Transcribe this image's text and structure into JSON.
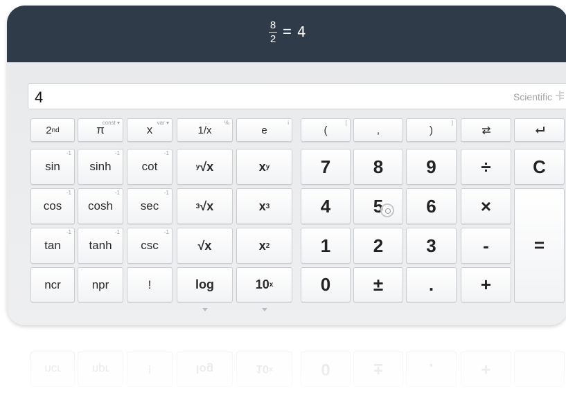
{
  "header": {
    "numerator": "8",
    "denominator": "2",
    "equals": "=",
    "result": "4"
  },
  "display": {
    "value": "4",
    "mode_label": "Scientific"
  },
  "keys": {
    "second": {
      "base": "2",
      "sup": "nd"
    },
    "pi": {
      "label": "π",
      "corner": "const ▾"
    },
    "x_var": {
      "label": "x",
      "corner": "var ▾"
    },
    "reciprocal": {
      "label": "1/x",
      "corner": "%"
    },
    "e": {
      "label": "e",
      "corner": "i"
    },
    "lparen": {
      "label": "(",
      "corner": "["
    },
    "comma": {
      "label": ","
    },
    "rparen": {
      "label": ")",
      "corner": "]"
    },
    "swap": {
      "icon": "swap-arrows-icon"
    },
    "backspace": {
      "icon": "backspace-arrow-icon"
    },
    "sin": {
      "label": "sin",
      "corner": "-1"
    },
    "sinh": {
      "label": "sinh",
      "corner": "-1"
    },
    "cot": {
      "label": "cot",
      "corner": "-1"
    },
    "y_root": {
      "sup": "y",
      "label": "√x"
    },
    "x_pow_y": {
      "label": "x",
      "sup": "y"
    },
    "seven": {
      "label": "7"
    },
    "eight": {
      "label": "8"
    },
    "nine": {
      "label": "9"
    },
    "divide": {
      "label": "÷"
    },
    "clear": {
      "label": "C"
    },
    "cos": {
      "label": "cos",
      "corner": "-1"
    },
    "cosh": {
      "label": "cosh",
      "corner": "-1"
    },
    "sec": {
      "label": "sec",
      "corner": "-1"
    },
    "cube_root": {
      "sup": "3",
      "label": "√x"
    },
    "x_cubed": {
      "label": "x",
      "sup": "3"
    },
    "four": {
      "label": "4"
    },
    "five": {
      "label": "5"
    },
    "six": {
      "label": "6"
    },
    "multiply": {
      "label": "×"
    },
    "equals": {
      "label": "="
    },
    "tan": {
      "label": "tan",
      "corner": "-1"
    },
    "tanh": {
      "label": "tanh",
      "corner": "-1"
    },
    "csc": {
      "label": "csc",
      "corner": "-1"
    },
    "sqrt": {
      "label": "√x"
    },
    "x_squared": {
      "label": "x",
      "sup": "2"
    },
    "one": {
      "label": "1"
    },
    "two": {
      "label": "2"
    },
    "three": {
      "label": "3"
    },
    "minus": {
      "label": "-"
    },
    "ncr": {
      "label": "ncr"
    },
    "npr": {
      "label": "npr"
    },
    "factorial": {
      "label": "!"
    },
    "log": {
      "label": "log"
    },
    "ten_pow": {
      "label": "10",
      "sup": "x"
    },
    "zero": {
      "label": "0"
    },
    "plus_minus": {
      "label": "±"
    },
    "decimal": {
      "label": "."
    },
    "plus": {
      "label": "+"
    }
  },
  "reflection": {
    "ncr": "ncr",
    "npr": "npr",
    "factorial": "!",
    "log": "log",
    "ten_pow": "10",
    "ten_sup": "x",
    "zero": "0",
    "plus_minus": "±",
    "decimal": ".",
    "plus": "+"
  },
  "colors": {
    "header_bg": "#2f3b48",
    "panel_bg": "#ebecee",
    "key_border": "#c9ccd0"
  }
}
